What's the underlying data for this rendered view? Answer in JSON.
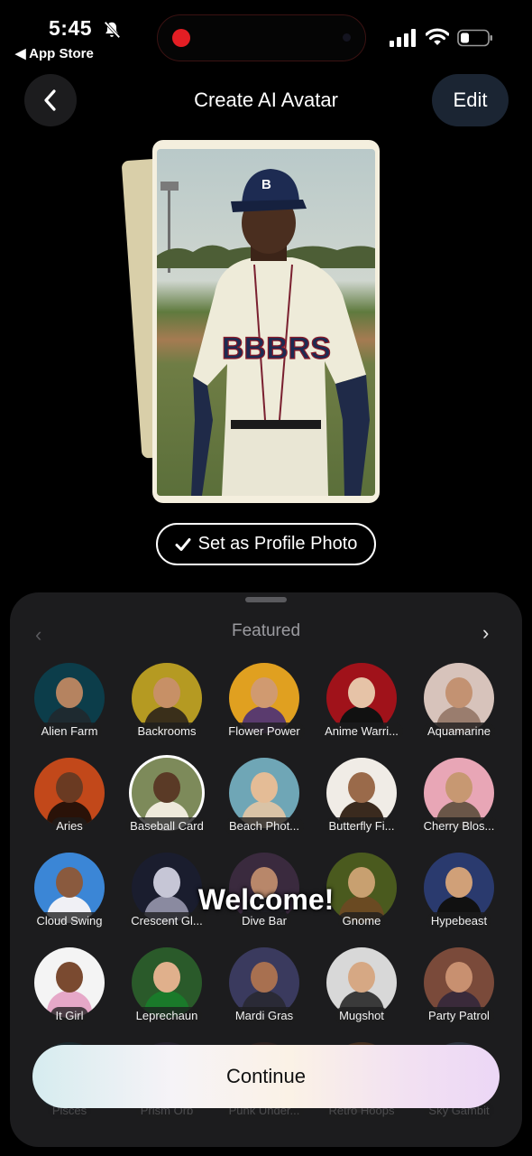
{
  "status_bar": {
    "time": "5:45",
    "back_app": "◀ App Store"
  },
  "header": {
    "title": "Create AI Avatar",
    "edit_label": "Edit"
  },
  "avatar_card": {
    "jersey_text": "BBBRS",
    "cap_letter": "B"
  },
  "set_profile_label": "Set as Profile Photo",
  "sheet": {
    "title": "Featured",
    "styles": [
      {
        "label": "Alien Farm",
        "bg": "#0c3d4a",
        "face": "#b58360",
        "body": "#1e2a30"
      },
      {
        "label": "Backrooms",
        "bg": "#b59a22",
        "face": "#c79066",
        "body": "#3a2f1a"
      },
      {
        "label": "Flower Power",
        "bg": "#e0a020",
        "face": "#d09a70",
        "body": "#5a3b6e"
      },
      {
        "label": "Anime Warri...",
        "bg": "#a0121a",
        "face": "#e6c3a7",
        "body": "#111111"
      },
      {
        "label": "Aquamarine",
        "bg": "#d7c3bb",
        "face": "#c39272",
        "body": "#9a7d6e"
      },
      {
        "label": "Aries",
        "bg": "#c2481a",
        "face": "#6a3a22",
        "body": "#2a1208"
      },
      {
        "label": "Baseball Card",
        "bg": "#7d8a5a",
        "face": "#5a3a26",
        "body": "#eeeadb"
      },
      {
        "label": "Beach Phot...",
        "bg": "#6fa6b6",
        "face": "#e4bc96",
        "body": "#d9c3a6"
      },
      {
        "label": "Butterfly Fi...",
        "bg": "#f0ece6",
        "face": "#9a6a4a",
        "body": "#3a2a1e"
      },
      {
        "label": "Cherry Blos...",
        "bg": "#e8a6b6",
        "face": "#c79872",
        "body": "#6a5648"
      },
      {
        "label": "Cloud Swing",
        "bg": "#3b86d6",
        "face": "#8a5a3e",
        "body": "#f0f0f5"
      },
      {
        "label": "Crescent Gl...",
        "bg": "#1a1d2e",
        "face": "#c6c6d6",
        "body": "#8a8aa0"
      },
      {
        "label": "Dive Bar",
        "bg": "#3a2a3e",
        "face": "#b8876a",
        "body": "#1e1e24"
      },
      {
        "label": "Gnome",
        "bg": "#4a5a1e",
        "face": "#c8a070",
        "body": "#6a4a22"
      },
      {
        "label": "Hypebeast",
        "bg": "#2a3a6e",
        "face": "#d0a078",
        "body": "#111111"
      },
      {
        "label": "It Girl",
        "bg": "#f4f4f4",
        "face": "#7a4a30",
        "body": "#e6a8c8"
      },
      {
        "label": "Leprechaun",
        "bg": "#2a5a2a",
        "face": "#e0b08c",
        "body": "#1a7a2a"
      },
      {
        "label": "Mardi Gras",
        "bg": "#3a3a5e",
        "face": "#a87050",
        "body": "#2a2a36"
      },
      {
        "label": "Mugshot",
        "bg": "#d8d8d8",
        "face": "#d6a884",
        "body": "#3a3a3a"
      },
      {
        "label": "Party Patrol",
        "bg": "#7a4a3a",
        "face": "#c89070",
        "body": "#3a2a3a"
      },
      {
        "label": "Pisces",
        "bg": "#1a5a6a",
        "face": "#a47050",
        "body": "#1a3a4a"
      },
      {
        "label": "Prism Orb",
        "bg": "#4a3a6a",
        "face": "#c09070",
        "body": "#2a2a3a"
      },
      {
        "label": "Punk Under...",
        "bg": "#6a3a2a",
        "face": "#c89a78",
        "body": "#1a1a1a"
      },
      {
        "label": "Retro Hoops",
        "bg": "#d87a2a",
        "face": "#8a5a3a",
        "body": "#e0d0b0"
      },
      {
        "label": "Sky Gambit",
        "bg": "#6a8ab6",
        "face": "#c8a080",
        "body": "#2a3a5a"
      }
    ]
  },
  "overlay_text": "Welcome!",
  "continue_label": "Continue"
}
